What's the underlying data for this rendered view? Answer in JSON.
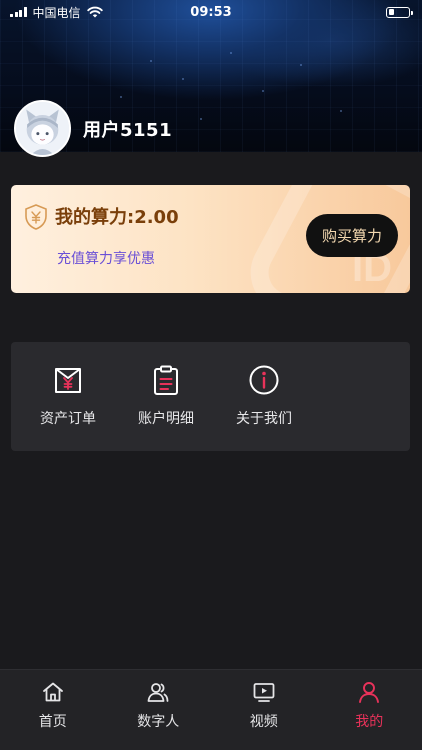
{
  "status_bar": {
    "carrier": "中国电信",
    "time": "09:53",
    "battery_level": 0.3
  },
  "profile": {
    "username": "用户5151",
    "avatar_icon": "avatar-cat-girl"
  },
  "compute_card": {
    "title": "我的算力:2.00",
    "subtitle": "充值算力享优惠",
    "buy_label": "购买算力",
    "icon": "shield-yuan-icon",
    "colors": {
      "title": "#7a3f0a",
      "subtitle": "#6a4fd6",
      "button_bg": "#111111",
      "button_text": "#f3d8b0"
    }
  },
  "menu": {
    "items": [
      {
        "label": "资产订单",
        "icon": "asset-order-icon"
      },
      {
        "label": "账户明细",
        "icon": "account-detail-icon"
      },
      {
        "label": "关于我们",
        "icon": "info-icon"
      }
    ],
    "accent": "#e8325a"
  },
  "tab_bar": {
    "items": [
      {
        "label": "首页",
        "icon": "home-icon",
        "active": false
      },
      {
        "label": "数字人",
        "icon": "digital-human-icon",
        "active": false
      },
      {
        "label": "视频",
        "icon": "video-icon",
        "active": false
      },
      {
        "label": "我的",
        "icon": "profile-icon",
        "active": true
      }
    ],
    "active_color": "#e8325a"
  }
}
